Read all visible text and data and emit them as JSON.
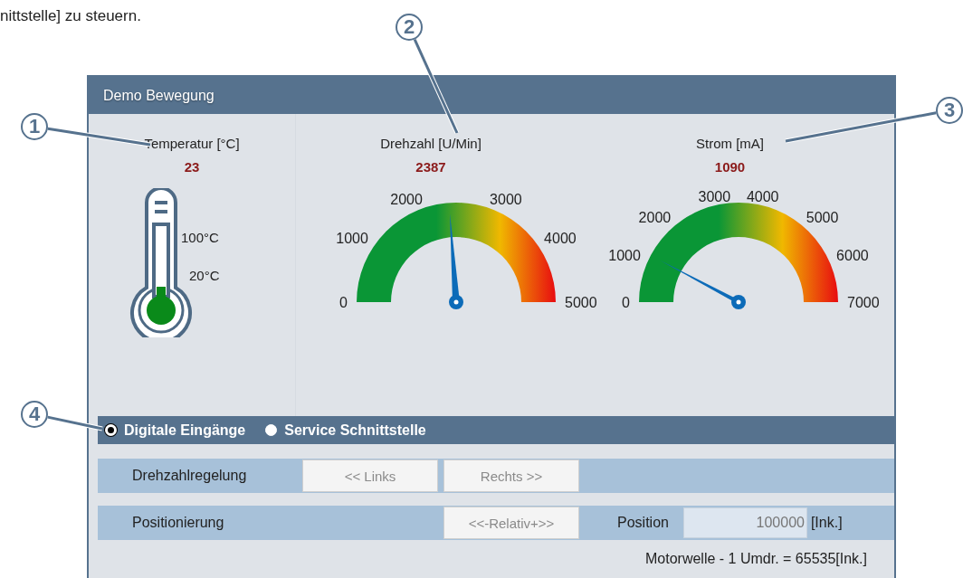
{
  "intro_text": "nittstelle] zu steuern.",
  "callouts": [
    {
      "label": "1",
      "kind": "left"
    },
    {
      "label": "2",
      "kind": "top"
    },
    {
      "label": "3",
      "kind": "right"
    },
    {
      "label": "4",
      "kind": "radio"
    }
  ],
  "window": {
    "title": "Demo Bewegung"
  },
  "thermometer": {
    "title": "Temperatur [°C]",
    "value": "23",
    "scale": [
      "100°C",
      "20°C"
    ]
  },
  "gauges": [
    {
      "title": "Drehzahl [U/Min]",
      "value": "2387",
      "ticks": [
        "0",
        "1000",
        "2000",
        "3000",
        "4000",
        "5000"
      ]
    },
    {
      "title": "Strom [mA]",
      "value": "1090",
      "ticks": [
        "0",
        "1000",
        "2000",
        "3000",
        "4000",
        "5000",
        "6000",
        "7000"
      ]
    }
  ],
  "mode": [
    {
      "label": "Digitale Eingänge",
      "selected": true
    },
    {
      "label": "Service Schnittstelle",
      "selected": false
    }
  ],
  "speed_row": {
    "label": "Drehzahlregelung",
    "buttons": [
      {
        "label": "<< Links",
        "disabled": true
      },
      {
        "label": "Rechts >>",
        "disabled": true
      }
    ]
  },
  "position_row": {
    "label": "Positionierung",
    "button": {
      "label": "<<-Relativ+>>",
      "disabled": true
    },
    "field_label": "Position",
    "field_value": "100000",
    "unit": "[Ink.]"
  },
  "footer": "Motorwelle - 1 Umdr. = 65535[Ink.]"
}
